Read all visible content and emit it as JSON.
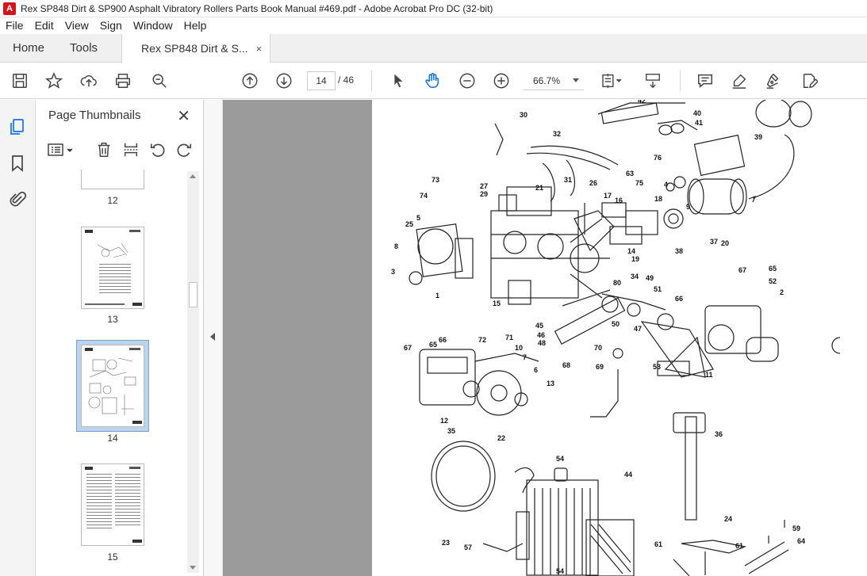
{
  "window": {
    "title": "Rex SP848 Dirt & SP900 Asphalt Vibratory Rollers Parts Book Manual #469.pdf - Adobe Acrobat Pro DC (32-bit)",
    "app_icon": "acrobat-logo"
  },
  "menu": [
    "File",
    "Edit",
    "View",
    "Sign",
    "Window",
    "Help"
  ],
  "tabs": {
    "home": "Home",
    "tools": "Tools",
    "document": "Rex SP848 Dirt & S...",
    "close": "×"
  },
  "toolbar": {
    "current_page": "14",
    "total_pages": "/ 46",
    "zoom": "66.7%"
  },
  "panel": {
    "title": "Page Thumbnails",
    "close": "✕",
    "thumbnails": [
      {
        "label": "12"
      },
      {
        "label": "13"
      },
      {
        "label": "14",
        "selected": true
      },
      {
        "label": "15"
      }
    ]
  },
  "colors": {
    "accent": "#1473e6",
    "brand_red": "#d4161c",
    "selection": "#bcd3ea",
    "doc_background": "#9b9b9b"
  },
  "diagram": {
    "part_numbers": [
      "30",
      "32",
      "42",
      "40",
      "41",
      "39",
      "73",
      "74",
      "27",
      "29",
      "21",
      "31",
      "63",
      "75",
      "76",
      "4",
      "5",
      "25",
      "26",
      "17",
      "16",
      "18",
      "9",
      "8",
      "3",
      "1",
      "15",
      "14",
      "19",
      "38",
      "37",
      "20",
      "80",
      "34",
      "49",
      "51",
      "66",
      "67",
      "65",
      "52",
      "2",
      "45",
      "46",
      "48",
      "50",
      "47",
      "68",
      "70",
      "69",
      "53",
      "11",
      "67",
      "65",
      "66",
      "72",
      "71",
      "10",
      "7",
      "6",
      "13",
      "12",
      "35",
      "22",
      "54",
      "44",
      "36",
      "24",
      "23",
      "57",
      "61",
      "61",
      "59",
      "64",
      "54"
    ]
  }
}
